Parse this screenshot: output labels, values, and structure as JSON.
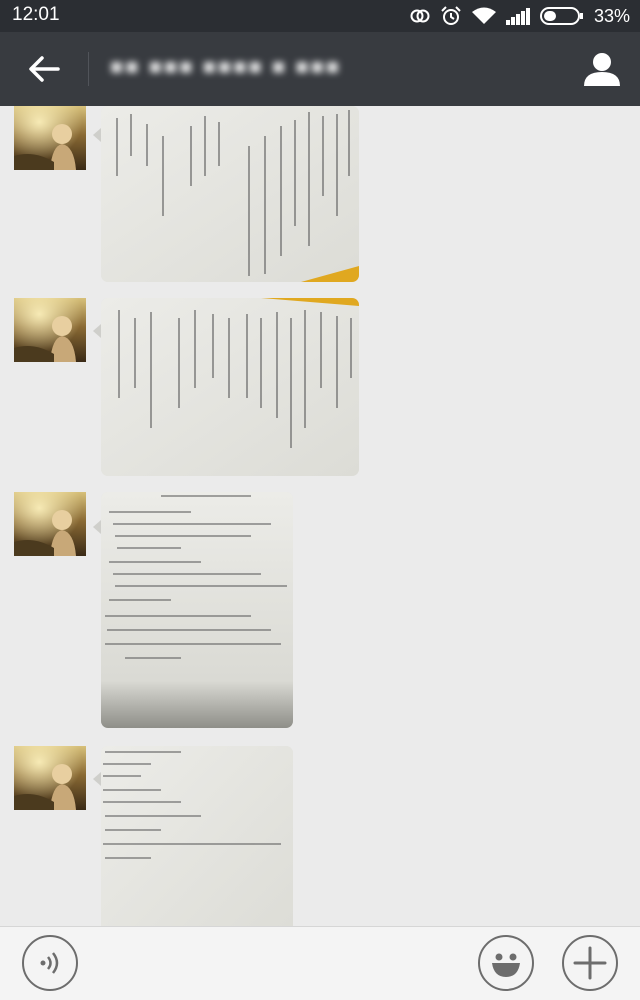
{
  "status_bar": {
    "time": "12:01",
    "battery_percent": "33%"
  },
  "header": {
    "title": "■■ ■■■ ■■■■ ■ ■■■"
  },
  "messages": [
    {
      "type": "image",
      "sender": "contact"
    },
    {
      "type": "image",
      "sender": "contact"
    },
    {
      "type": "image",
      "sender": "contact"
    },
    {
      "type": "image",
      "sender": "contact"
    }
  ],
  "icons": {
    "back": "arrow-left-icon",
    "profile": "person-icon",
    "voice": "voice-icon",
    "emoji": "smiley-icon",
    "more": "plus-icon"
  },
  "colors": {
    "status_bar": "#2b2e33",
    "title_bar": "#383b40",
    "chat_bg": "#ebebeb",
    "input_bar": "#f4f4f4"
  }
}
